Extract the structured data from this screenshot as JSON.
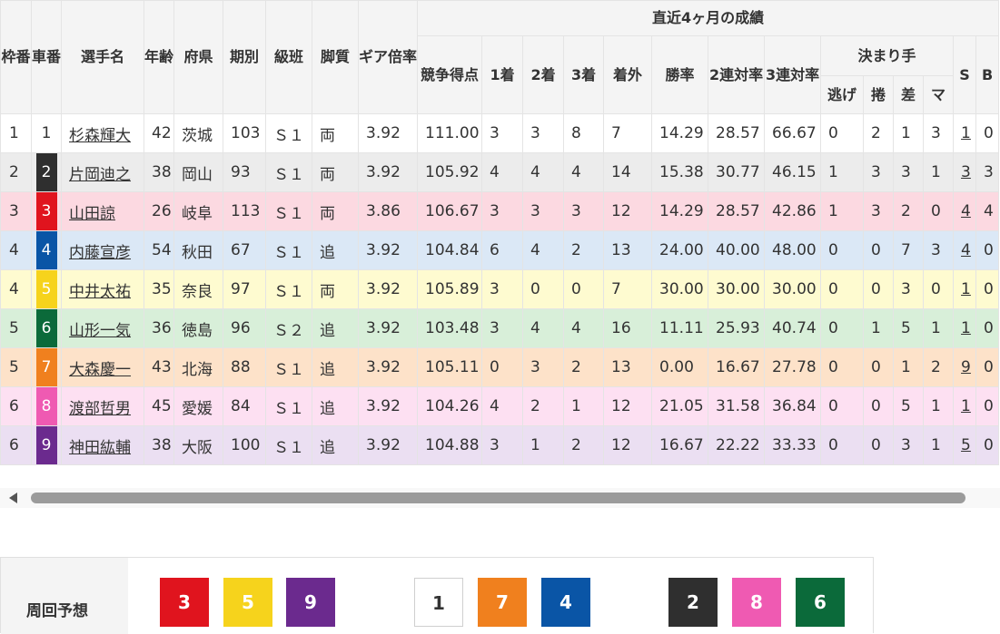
{
  "table": {
    "headers": {
      "waku": "枠番",
      "car": "車番",
      "name": "選手名",
      "age": "年齢",
      "pref": "府県",
      "term": "期別",
      "class": "級班",
      "style": "脚質",
      "gear": "ギア倍率",
      "recent": "直近4ヶ月の成績",
      "score": "競争得点",
      "first": "1着",
      "second": "2着",
      "third": "3着",
      "out": "着外",
      "win": "勝率",
      "quinella": "2連対率",
      "trio": "3連対率",
      "kimarite": "決まり手",
      "nige": "逃げ",
      "makuri": "捲",
      "sashi": "差",
      "mark": "マ",
      "s": "S",
      "b": "B"
    },
    "rows": [
      {
        "waku": "1",
        "car": "1",
        "car_bg": "#ffffff",
        "car_fg": "#333333",
        "name": "杉森輝大",
        "age": "42",
        "pref": "茨城",
        "term": "103",
        "class": "Ｓ１",
        "style": "両",
        "gear": "3.92",
        "score": "111.00",
        "first": "3",
        "second": "3",
        "third": "8",
        "out": "7",
        "win": "14.29",
        "quinella": "28.57",
        "trio": "66.67",
        "nige": "0",
        "makuri": "2",
        "sashi": "1",
        "mark": "3",
        "s": "1",
        "b": "0"
      },
      {
        "waku": "2",
        "car": "2",
        "car_bg": "#2f2f2f",
        "car_fg": "#ffffff",
        "name": "片岡迪之",
        "age": "38",
        "pref": "岡山",
        "term": "93",
        "class": "Ｓ１",
        "style": "両",
        "gear": "3.92",
        "score": "105.92",
        "first": "4",
        "second": "4",
        "third": "4",
        "out": "14",
        "win": "15.38",
        "quinella": "30.77",
        "trio": "46.15",
        "nige": "1",
        "makuri": "3",
        "sashi": "3",
        "mark": "1",
        "s": "3",
        "b": "3"
      },
      {
        "waku": "3",
        "car": "3",
        "car_bg": "#e0141e",
        "car_fg": "#ffffff",
        "name": "山田諒",
        "age": "26",
        "pref": "岐阜",
        "term": "113",
        "class": "Ｓ１",
        "style": "両",
        "gear": "3.86",
        "score": "106.67",
        "first": "3",
        "second": "3",
        "third": "3",
        "out": "12",
        "win": "14.29",
        "quinella": "28.57",
        "trio": "42.86",
        "nige": "1",
        "makuri": "3",
        "sashi": "2",
        "mark": "0",
        "s": "4",
        "b": "4"
      },
      {
        "waku": "4",
        "car": "4",
        "car_bg": "#0a55a6",
        "car_fg": "#ffffff",
        "name": "内藤宣彦",
        "age": "54",
        "pref": "秋田",
        "term": "67",
        "class": "Ｓ１",
        "style": "追",
        "gear": "3.92",
        "score": "104.84",
        "first": "6",
        "second": "4",
        "third": "2",
        "out": "13",
        "win": "24.00",
        "quinella": "40.00",
        "trio": "48.00",
        "nige": "0",
        "makuri": "0",
        "sashi": "7",
        "mark": "3",
        "s": "4",
        "b": "0"
      },
      {
        "waku": "4",
        "car": "5",
        "car_bg": "#f6d31c",
        "car_fg": "#ffffff",
        "name": "中井太祐",
        "age": "35",
        "pref": "奈良",
        "term": "97",
        "class": "Ｓ１",
        "style": "両",
        "gear": "3.92",
        "score": "105.89",
        "first": "3",
        "second": "0",
        "third": "0",
        "out": "7",
        "win": "30.00",
        "quinella": "30.00",
        "trio": "30.00",
        "nige": "0",
        "makuri": "0",
        "sashi": "3",
        "mark": "0",
        "s": "1",
        "b": "0"
      },
      {
        "waku": "5",
        "car": "6",
        "car_bg": "#0b6a3a",
        "car_fg": "#ffffff",
        "name": "山形一気",
        "age": "36",
        "pref": "徳島",
        "term": "96",
        "class": "Ｓ２",
        "style": "追",
        "gear": "3.92",
        "score": "103.48",
        "first": "3",
        "second": "4",
        "third": "4",
        "out": "16",
        "win": "11.11",
        "quinella": "25.93",
        "trio": "40.74",
        "nige": "0",
        "makuri": "1",
        "sashi": "5",
        "mark": "1",
        "s": "1",
        "b": "0"
      },
      {
        "waku": "5",
        "car": "7",
        "car_bg": "#f0801e",
        "car_fg": "#ffffff",
        "name": "大森慶一",
        "age": "43",
        "pref": "北海",
        "term": "88",
        "class": "Ｓ１",
        "style": "追",
        "gear": "3.92",
        "score": "105.11",
        "first": "0",
        "second": "3",
        "third": "2",
        "out": "13",
        "win": "0.00",
        "quinella": "16.67",
        "trio": "27.78",
        "nige": "0",
        "makuri": "0",
        "sashi": "1",
        "mark": "2",
        "s": "9",
        "b": "0"
      },
      {
        "waku": "6",
        "car": "8",
        "car_bg": "#ef5ab2",
        "car_fg": "#ffffff",
        "name": "渡部哲男",
        "age": "45",
        "pref": "愛媛",
        "term": "84",
        "class": "Ｓ１",
        "style": "追",
        "gear": "3.92",
        "score": "104.26",
        "first": "4",
        "second": "2",
        "third": "1",
        "out": "12",
        "win": "21.05",
        "quinella": "31.58",
        "trio": "36.84",
        "nige": "0",
        "makuri": "0",
        "sashi": "5",
        "mark": "1",
        "s": "1",
        "b": "0"
      },
      {
        "waku": "6",
        "car": "9",
        "car_bg": "#6b2a8e",
        "car_fg": "#ffffff",
        "name": "神田紘輔",
        "age": "38",
        "pref": "大阪",
        "term": "100",
        "class": "Ｓ１",
        "style": "追",
        "gear": "3.92",
        "score": "104.88",
        "first": "3",
        "second": "1",
        "third": "2",
        "out": "12",
        "win": "16.67",
        "quinella": "22.22",
        "trio": "33.33",
        "nige": "0",
        "makuri": "0",
        "sashi": "3",
        "mark": "1",
        "s": "5",
        "b": "0"
      }
    ]
  },
  "forecast": {
    "label": "周回予想",
    "boxes": [
      {
        "num": "3",
        "bg": "#e0141e",
        "fg": "#ffffff"
      },
      {
        "num": "5",
        "bg": "#f6d31c",
        "fg": "#ffffff"
      },
      {
        "num": "9",
        "bg": "#6b2a8e",
        "fg": "#ffffff"
      },
      {
        "num": "1",
        "bg": "#ffffff",
        "fg": "#333333"
      },
      {
        "num": "7",
        "bg": "#f0801e",
        "fg": "#ffffff"
      },
      {
        "num": "4",
        "bg": "#0a55a6",
        "fg": "#ffffff"
      },
      {
        "num": "2",
        "bg": "#2f2f2f",
        "fg": "#ffffff"
      },
      {
        "num": "8",
        "bg": "#ef5ab2",
        "fg": "#ffffff"
      },
      {
        "num": "6",
        "bg": "#0b6a3a",
        "fg": "#ffffff"
      }
    ]
  }
}
